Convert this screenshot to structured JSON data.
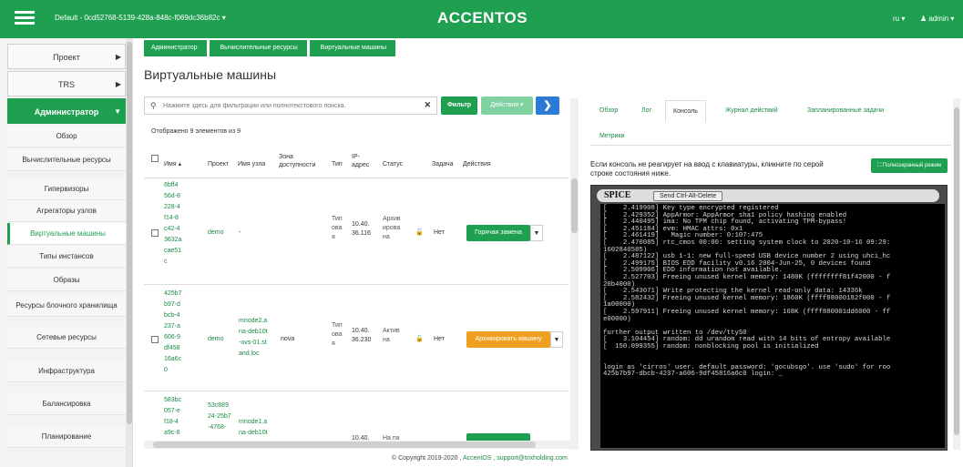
{
  "topbar": {
    "project_selector": "Default - 0cd52768-5139-428a-848c-f069dc36b82c ▾",
    "logo": "ACCENTOS",
    "language": "ru ▾",
    "user": "admin ▾"
  },
  "sidebar": {
    "items": [
      {
        "label": "Проект",
        "type": "main"
      },
      {
        "label": "TRS",
        "type": "main"
      },
      {
        "label": "Администратор",
        "type": "main",
        "active": true
      },
      {
        "label": "Обзор",
        "type": "sub"
      },
      {
        "label": "Вычислительные ресурсы",
        "type": "sub"
      },
      {
        "label": "Гипервизоры",
        "type": "sub"
      },
      {
        "label": "Агрегаторы узлов",
        "type": "sub"
      },
      {
        "label": "Виртуальные машины",
        "type": "sub",
        "active": true
      },
      {
        "label": "Типы инстансов",
        "type": "sub"
      },
      {
        "label": "Образы",
        "type": "sub"
      },
      {
        "label": "Ресурсы блочного хранилища",
        "type": "sub"
      },
      {
        "label": "Сетевые ресурсы",
        "type": "sub"
      },
      {
        "label": "Инфраструктура",
        "type": "sub"
      },
      {
        "label": "Балансировка",
        "type": "sub"
      },
      {
        "label": "Планирование",
        "type": "sub"
      }
    ]
  },
  "breadcrumb": [
    "Администратор",
    "Вычислительные ресурсы",
    "Виртуальные машины"
  ],
  "page_title": "Виртуальные машины",
  "toolbar": {
    "search_placeholder": "Нажмите здесь для фильтрации или полнотекстового поиска.",
    "filter_label": "Фильтр",
    "actions_label": "Действия ▾",
    "next_label": "❯"
  },
  "count_text": "Отображено 9 элементов из 9",
  "table": {
    "columns": {
      "name": "Имя ▴",
      "project": "Проект",
      "host": "Имя узла",
      "zone": "Зона\nдоступности",
      "type": "Тип",
      "ip": "IP-\nадрес",
      "status": "Статус",
      "task": "Задача",
      "actions": "Действия"
    },
    "rows": [
      {
        "name": "6bff4\n56d-8\n228-4\nf14-8\nc42-4\n3632a\ncae51\nc",
        "project": "demo",
        "host": "-",
        "zone": "",
        "type": "Тип\nова\nя",
        "ip": "10.40.\n36.116",
        "status": "Архив\nирова\nна",
        "task": "Нет",
        "action": "Горячая замена",
        "action_color": "#1fa050"
      },
      {
        "name": "425b7\nb97-d\nbcb-4\n237-a\n606-9\ndf458\n16a6c\n0",
        "project": "demo",
        "host": "mnode2.a\nna-deb10t\n-ovs-01.st\nand.loc",
        "zone": "nova",
        "type": "Тип\nова\nя",
        "ip": "10.40.\n36.230",
        "status": "Актив\nна",
        "task": "Нет",
        "action": "Архивировать машину",
        "action_color": "#f0a020"
      },
      {
        "name": "583bc\n057-e\nf18-4\na9c-8",
        "project": "53c889\n24-25b7\n-4768-",
        "host": "\nmnode1.a\nna-deb10t",
        "zone": "",
        "type": "",
        "ip": "\n\n\n10.40.",
        "status": "\n\n\nНа па",
        "task": "",
        "action": "",
        "action_color": "#1fa050"
      }
    ]
  },
  "detail_tabs": [
    "Обзор",
    "Лог",
    "Консоль",
    "Журнал действий",
    "Запланированные задачи",
    "Метрики"
  ],
  "active_tab": "Консоль",
  "console": {
    "message": "Если консоль не реагирует на ввод с клавиатуры, кликните по серой строке состояния ниже.",
    "fullscreen_label": "⛶ Полноэкранный режим",
    "spice_label": "SPICE",
    "cad_label": "Send Ctrl-Alt-Delete",
    "terminal_text": "[    2.419908] Key type encrypted registered\n[    2.429352] AppArmor: AppArmor sha1 policy hashing enabled\n[    2.440495] ima: No TPM chip found, activating TPM-bypass!\n[    2.451184] evm: HMAC attrs: 0x1\n[    2.461419]   Magic number: 0:107:475\n[    2.470085] rtc_cmos 00:00: setting system clock to 2020-10-16 09:29:\n1602840585)\n[    2.487122] usb 1-1: new full-speed USB device number 2 using uhci_hc\n[    2.499175] BIOS EDD facility v0.16 2004-Jun-25, 0 devices found\n[    2.509906] EDD information not available.\n[    2.527703] Freeing unused kernel memory: 1480K (ffffffff81f42000 - f\n20b4000)\n[    2.543071] Write protecting the kernel read-only data: 14336k\n[    2.582432] Freeing unused kernel memory: 1860K (ffff88000182f000 - f\n1a00000)\n[    2.597911] Freeing unused kernel memory: 168K (ffff880001dd6000 - ff\ne00000)\n\nfurther output written to /dev/ttyS0\n[    3.104454] random: dd urandom read with 14 bits of entropy available\n[  150.099355] random: nonblocking pool is initialized\n\n\nlogin as 'cirros' user. default password: 'gocubsgo'. use 'sudo' for roo\n425b7b97-dbcb-4237-a606-9df45816a6c0 login: _"
  },
  "footer": {
    "copyright": "© Copyright 2019-2020 ,",
    "brand": "AccentOS",
    "sep": " , ",
    "email": "support@tnxholding.com"
  }
}
